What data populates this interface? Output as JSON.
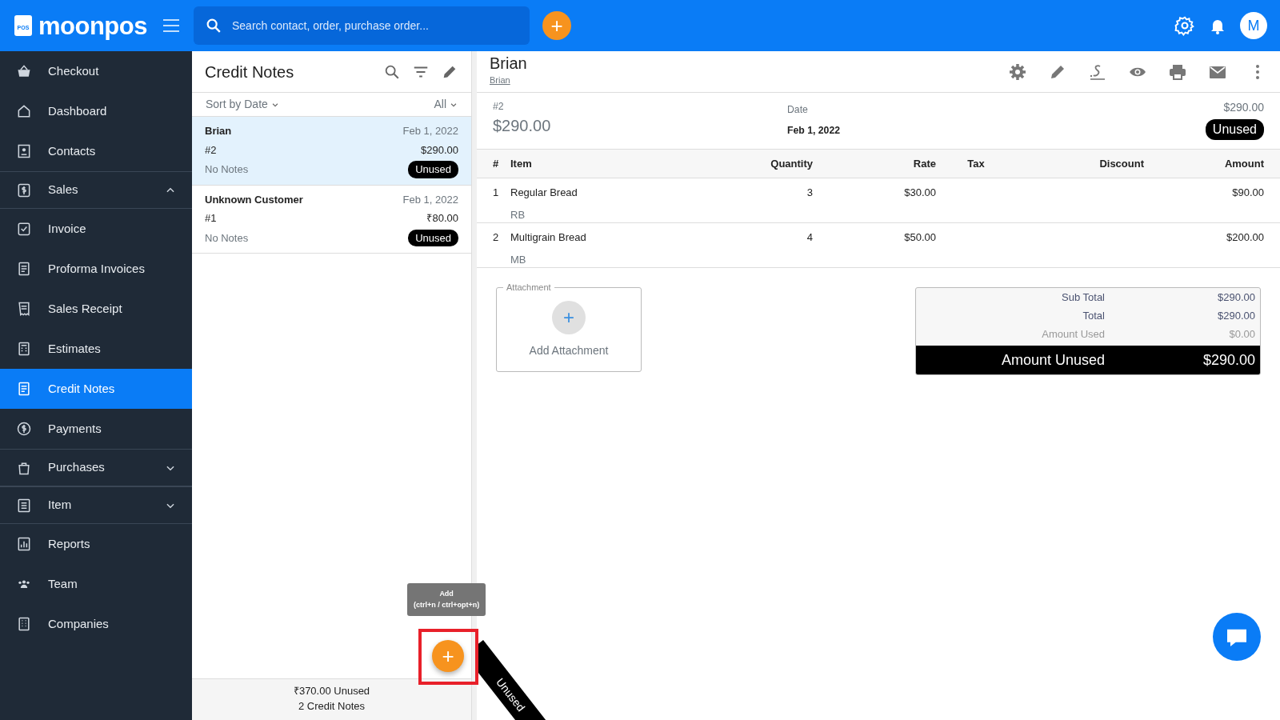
{
  "topbar": {
    "brand": "moonpos",
    "logo_text": "POS",
    "search": {
      "placeholder": "Search contact, order, purchase order..."
    },
    "add_button": "+",
    "avatar": "M"
  },
  "sidebar": {
    "items": [
      {
        "label": "Checkout",
        "selected": false
      },
      {
        "label": "Dashboard",
        "selected": false
      },
      {
        "label": "Contacts",
        "selected": false
      },
      {
        "label": "Sales",
        "selected": false,
        "expanded": true
      },
      {
        "label": "Invoice",
        "selected": false
      },
      {
        "label": "Proforma Invoices",
        "selected": false
      },
      {
        "label": "Sales Receipt",
        "selected": false
      },
      {
        "label": "Estimates",
        "selected": false
      },
      {
        "label": "Credit Notes",
        "selected": true
      },
      {
        "label": "Payments",
        "selected": false
      },
      {
        "label": "Purchases",
        "selected": false,
        "expanded": false
      },
      {
        "label": "Item",
        "selected": false,
        "expanded": false
      },
      {
        "label": "Reports",
        "selected": false
      },
      {
        "label": "Team",
        "selected": false
      },
      {
        "label": "Companies",
        "selected": false
      }
    ]
  },
  "list": {
    "title": "Credit Notes",
    "sort": "Sort by Date",
    "filter": "All",
    "items": [
      {
        "name": "Brian",
        "date": "Feb 1, 2022",
        "number": "#2",
        "amount": "$290.00",
        "notes": "No Notes",
        "status": "Unused",
        "selected": true
      },
      {
        "name": "Unknown Customer",
        "date": "Feb 1, 2022",
        "number": "#1",
        "amount": "₹80.00",
        "notes": "No Notes",
        "status": "Unused",
        "selected": false
      }
    ],
    "tooltip": {
      "title": "Add",
      "shortcut": "(ctrl+n / ctrl+opt+n)"
    },
    "fab": "+",
    "footer": {
      "total": "₹370.00 Unused",
      "count": "2 Credit Notes"
    }
  },
  "detail": {
    "title": "Brian",
    "subtitle": "Brian",
    "number": "#2",
    "amount": "$290.00",
    "date_label": "Date",
    "date": "Feb 1, 2022",
    "right_amount": "$290.00",
    "status": "Unused",
    "table": {
      "columns": [
        "#",
        "Item",
        "Quantity",
        "Rate",
        "Tax",
        "Discount",
        "Amount"
      ],
      "rows": [
        {
          "index": "1",
          "item": "Regular Bread",
          "code": "RB",
          "quantity": "3",
          "rate": "$30.00",
          "amount": "$90.00"
        },
        {
          "index": "2",
          "item": "Multigrain Bread",
          "code": "MB",
          "quantity": "4",
          "rate": "$50.00",
          "amount": "$200.00"
        }
      ]
    },
    "attachment": {
      "legend": "Attachment",
      "button": "+",
      "label": "Add Attachment"
    },
    "totals": [
      {
        "label": "Sub Total",
        "value": "$290.00",
        "kind": "normal"
      },
      {
        "label": "Total",
        "value": "$290.00",
        "kind": "normal"
      },
      {
        "label": "Amount Used",
        "value": "$0.00",
        "kind": "muted"
      },
      {
        "label": "Amount Unused",
        "value": "$290.00",
        "kind": "grand"
      }
    ],
    "ribbon": "Unused"
  }
}
